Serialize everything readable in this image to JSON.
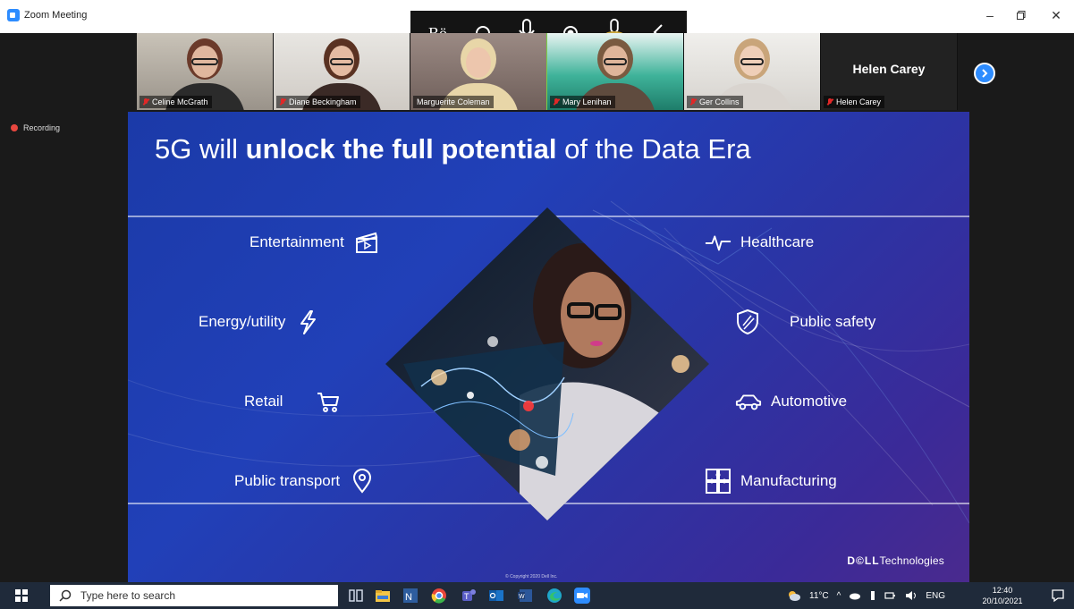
{
  "window": {
    "title": "Zoom Meeting",
    "controls": [
      "minimize",
      "maximize",
      "close"
    ]
  },
  "meeting_toolbar": {
    "icons": [
      "bo-status-icon",
      "circle-icon",
      "microphone-icon",
      "record-icon",
      "audio-active-icon",
      "chevron-left-icon"
    ]
  },
  "participants": [
    {
      "name": "Celine McGrath",
      "muted": true,
      "active": false
    },
    {
      "name": "Diane Beckingham",
      "muted": true,
      "active": false
    },
    {
      "name": "Marguerite Coleman",
      "muted": false,
      "active": true
    },
    {
      "name": "Mary Lenihan",
      "muted": true,
      "active": false
    },
    {
      "name": "Ger Collins",
      "muted": true,
      "active": false
    },
    {
      "name": "Helen Carey",
      "display_name": "Helen Carey",
      "muted": true,
      "active": false,
      "video": false
    }
  ],
  "recording": {
    "label": "Recording"
  },
  "slide": {
    "title_part1": "5G will ",
    "title_bold": "unlock the full potential",
    "title_part2": " of the Data Era",
    "left_sectors": [
      {
        "label": "Entertainment",
        "icon": "clapperboard-icon"
      },
      {
        "label": "Energy/utility",
        "icon": "lightning-icon"
      },
      {
        "label": "Retail",
        "icon": "shopping-cart-icon"
      },
      {
        "label": "Public transport",
        "icon": "map-pin-icon"
      }
    ],
    "right_sectors": [
      {
        "label": "Healthcare",
        "icon": "heartbeat-icon"
      },
      {
        "label": "Public safety",
        "icon": "shield-icon"
      },
      {
        "label": "Automotive",
        "icon": "car-icon"
      },
      {
        "label": "Manufacturing",
        "icon": "puzzle-icon"
      }
    ],
    "copyright": "© Copyright 2020 Dell Inc.",
    "brand_bold": "D©LL",
    "brand_rest": "Technologies"
  },
  "taskbar": {
    "search_placeholder": "Type here to search",
    "apps": [
      "task-view-icon",
      "file-explorer-icon",
      "project-icon",
      "chrome-icon",
      "teams-icon",
      "outlook-icon",
      "word-icon",
      "edge-icon",
      "zoom-icon"
    ],
    "weather": "11°C",
    "language": "ENG",
    "time": "12:40",
    "date": "20/10/2021"
  },
  "colors": {
    "zoom_blue": "#2d8cff",
    "recording_red": "#e8473f",
    "active_speaker": "#7bd148",
    "slide_blue": "#1b3aa8",
    "slide_purple": "#4a2a8e"
  }
}
